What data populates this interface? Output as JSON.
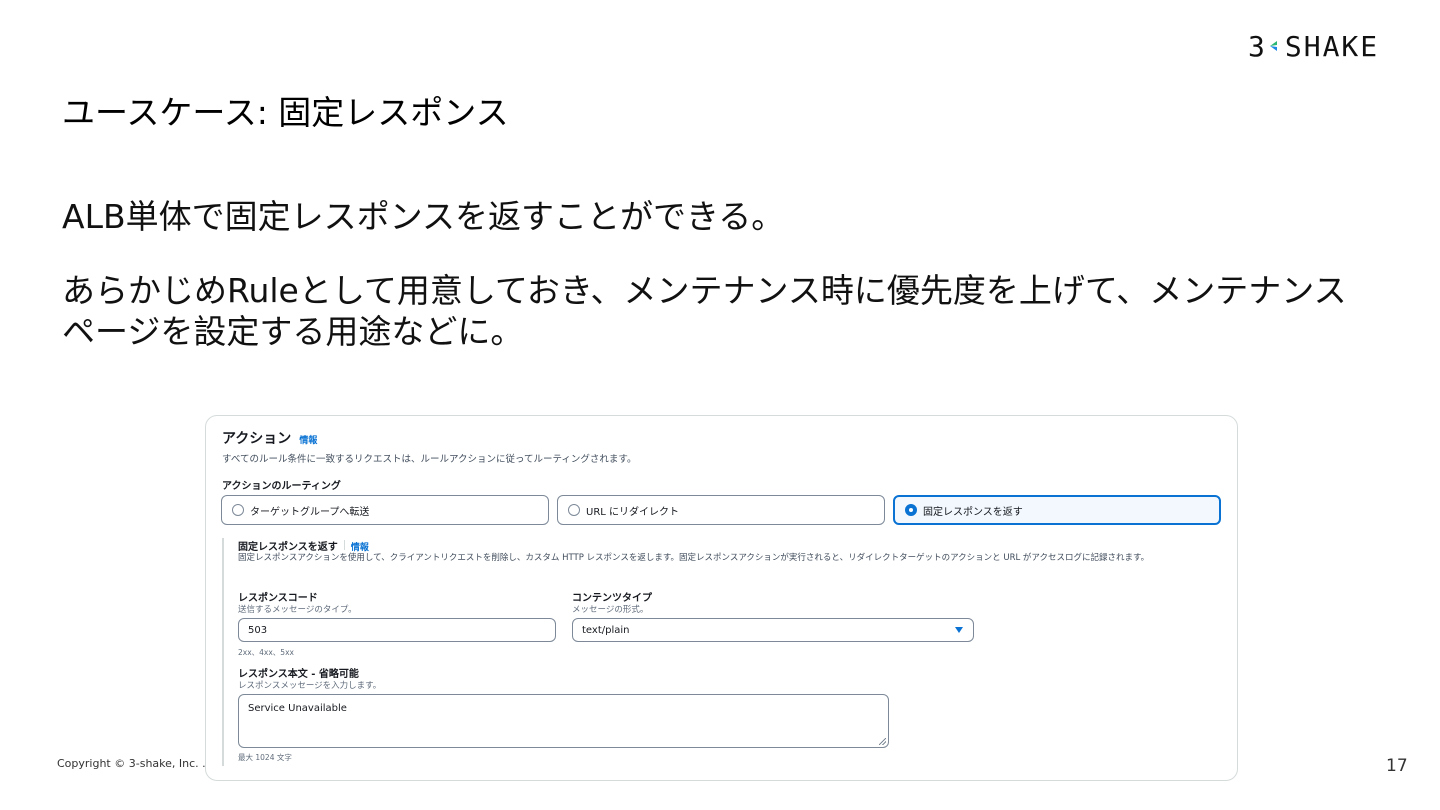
{
  "logo": {
    "num": "3",
    "text": "SHAKE"
  },
  "slide": {
    "title": "ユースケース: 固定レスポンス",
    "line1": "ALB単体で固定レスポンスを返すことができる。",
    "line2": "あらかじめRuleとして用意しておき、メンテナンス時に優先度を上げて、メンテナンスページを設定する用途などに。"
  },
  "panel": {
    "title": "アクション",
    "info": "情報",
    "description": "すべてのルール条件に一致するリクエストは、ルールアクションに従ってルーティングされます。",
    "routing_label": "アクションのルーティング",
    "options": [
      {
        "label": "ターゲットグループへ転送",
        "selected": false
      },
      {
        "label": "URL にリダイレクト",
        "selected": false
      },
      {
        "label": "固定レスポンスを返す",
        "selected": true
      }
    ],
    "fixed": {
      "title": "固定レスポンスを返す",
      "info": "情報",
      "description": "固定レスポンスアクションを使用して、クライアントリクエストを削除し、カスタム HTTP レスポンスを返します。固定レスポンスアクションが実行されると、リダイレクトターゲットのアクションと URL がアクセスログに記録されます。",
      "response_code": {
        "label": "レスポンスコード",
        "desc": "送信するメッセージのタイプ。",
        "value": "503",
        "hint": "2xx、4xx、5xx"
      },
      "content_type": {
        "label": "コンテンツタイプ",
        "desc": "メッセージの形式。",
        "value": "text/plain"
      },
      "body": {
        "label": "レスポンス本文 - 省略可能",
        "desc": "レスポンスメッセージを入力します。",
        "value": "Service Unavailable",
        "hint": "最大 1024 文字"
      }
    }
  },
  "footer": {
    "copyright": "Copyright © 3-shake, Inc. .",
    "page": "17"
  },
  "colors": {
    "accent": "#0972d3",
    "border": "#7d8998",
    "logo_green": "#2bb673",
    "logo_blue": "#1e88e5"
  }
}
